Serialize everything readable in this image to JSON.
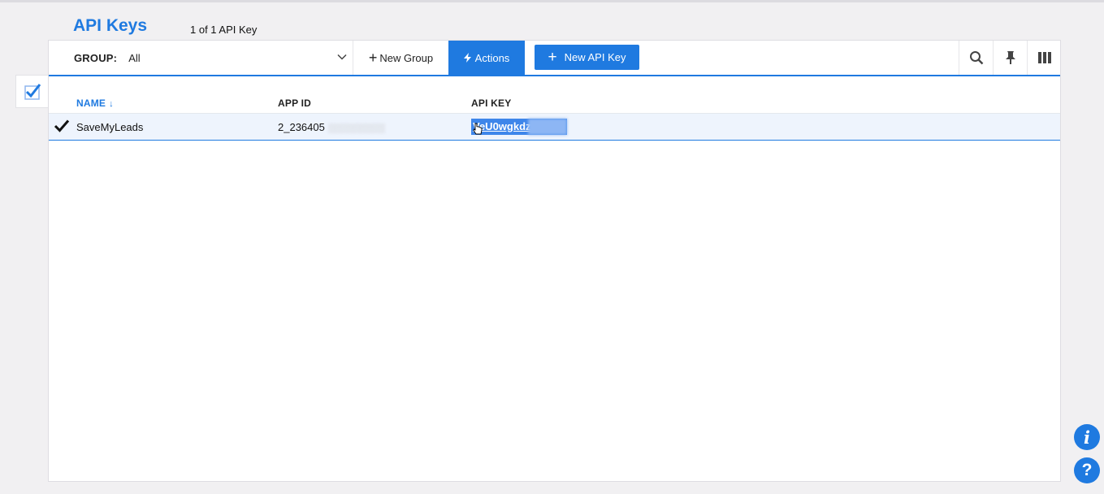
{
  "header": {
    "title": "API Keys",
    "count": "1 of 1 API Key"
  },
  "toolbar": {
    "group_label": "GROUP:",
    "group_value": "All",
    "new_group": "New Group",
    "actions": "Actions",
    "new_api_key": "New API Key",
    "icons": [
      "search-icon",
      "pin-icon",
      "columns-icon"
    ]
  },
  "table": {
    "columns": [
      "NAME",
      "APP ID",
      "API KEY"
    ],
    "sort_indicator": "↓",
    "rows": [
      {
        "name": "SaveMyLeads",
        "app_id": "2_236405",
        "api_key": "VeU0wgkdz",
        "selected": true
      }
    ]
  },
  "colors": {
    "accent": "#1f7ae0",
    "background": "#f1f0f2",
    "row_selected": "#eef4fd"
  }
}
